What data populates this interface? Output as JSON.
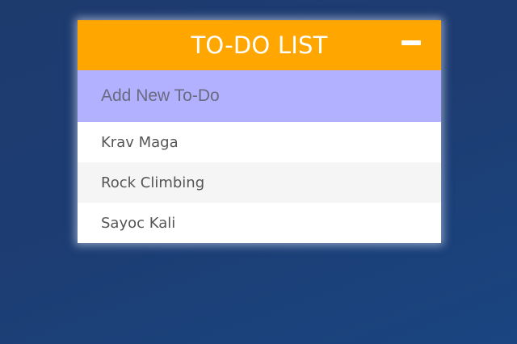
{
  "card": {
    "title": "TO-DO LIST",
    "collapse_icon": "minus-icon"
  },
  "new_todo": {
    "placeholder": "Add New To-Do",
    "value": ""
  },
  "todos": [
    {
      "text": "Krav Maga"
    },
    {
      "text": "Rock Climbing"
    },
    {
      "text": "Sayoc Kali"
    }
  ],
  "colors": {
    "header": "#ffa600",
    "input_row": "#b1b1ff",
    "background": "#1e3b6e"
  }
}
